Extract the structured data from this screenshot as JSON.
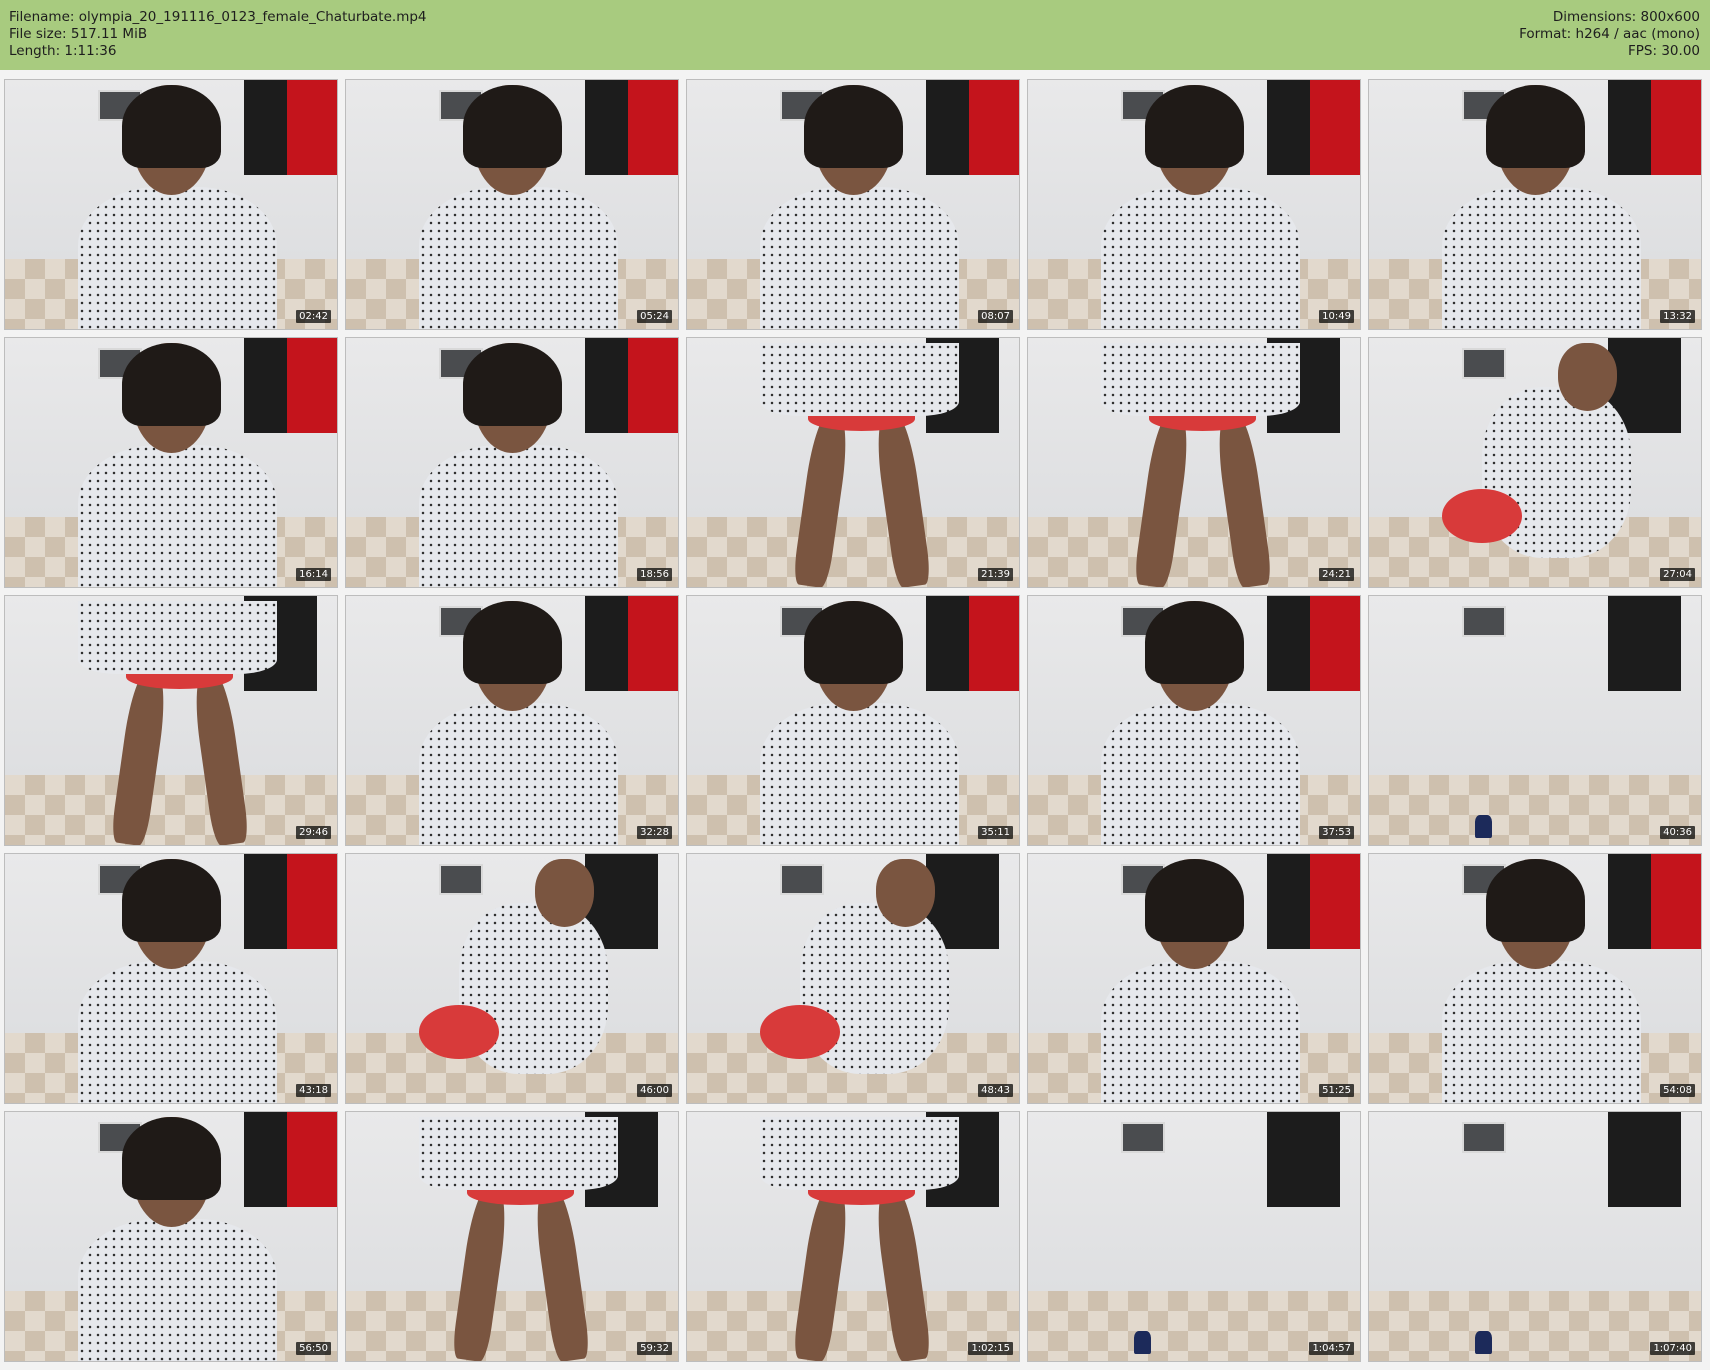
{
  "header": {
    "filename_label": "Filename: olympia_20_191116_0123_female_Chaturbate.mp4",
    "filesize_label": "File size: 517.11 MiB",
    "length_label": "Length: 1:11:36",
    "dimensions_label": "Dimensions: 800x600",
    "format_label": "Format: h264 / aac (mono)",
    "fps_label": "FPS: 30.00"
  },
  "thumbnails": [
    {
      "time": "02:42",
      "scene": "face"
    },
    {
      "time": "05:24",
      "scene": "face"
    },
    {
      "time": "08:07",
      "scene": "face"
    },
    {
      "time": "10:49",
      "scene": "face"
    },
    {
      "time": "13:32",
      "scene": "face"
    },
    {
      "time": "16:14",
      "scene": "face"
    },
    {
      "time": "18:56",
      "scene": "face"
    },
    {
      "time": "21:39",
      "scene": "legs"
    },
    {
      "time": "24:21",
      "scene": "legs"
    },
    {
      "time": "27:04",
      "scene": "bend"
    },
    {
      "time": "29:46",
      "scene": "legs"
    },
    {
      "time": "32:28",
      "scene": "face"
    },
    {
      "time": "35:11",
      "scene": "face"
    },
    {
      "time": "37:53",
      "scene": "face"
    },
    {
      "time": "40:36",
      "scene": "empty"
    },
    {
      "time": "43:18",
      "scene": "face"
    },
    {
      "time": "46:00",
      "scene": "bend"
    },
    {
      "time": "48:43",
      "scene": "bend"
    },
    {
      "time": "51:25",
      "scene": "face"
    },
    {
      "time": "54:08",
      "scene": "face"
    },
    {
      "time": "56:50",
      "scene": "face"
    },
    {
      "time": "59:32",
      "scene": "legs"
    },
    {
      "time": "1:02:15",
      "scene": "legs"
    },
    {
      "time": "1:04:57",
      "scene": "empty"
    },
    {
      "time": "1:07:40",
      "scene": "empty"
    }
  ],
  "colors": {
    "header_bg": "#a8cb7f",
    "page_bg": "#f3f3f3",
    "accent_red": "#c4141c"
  }
}
